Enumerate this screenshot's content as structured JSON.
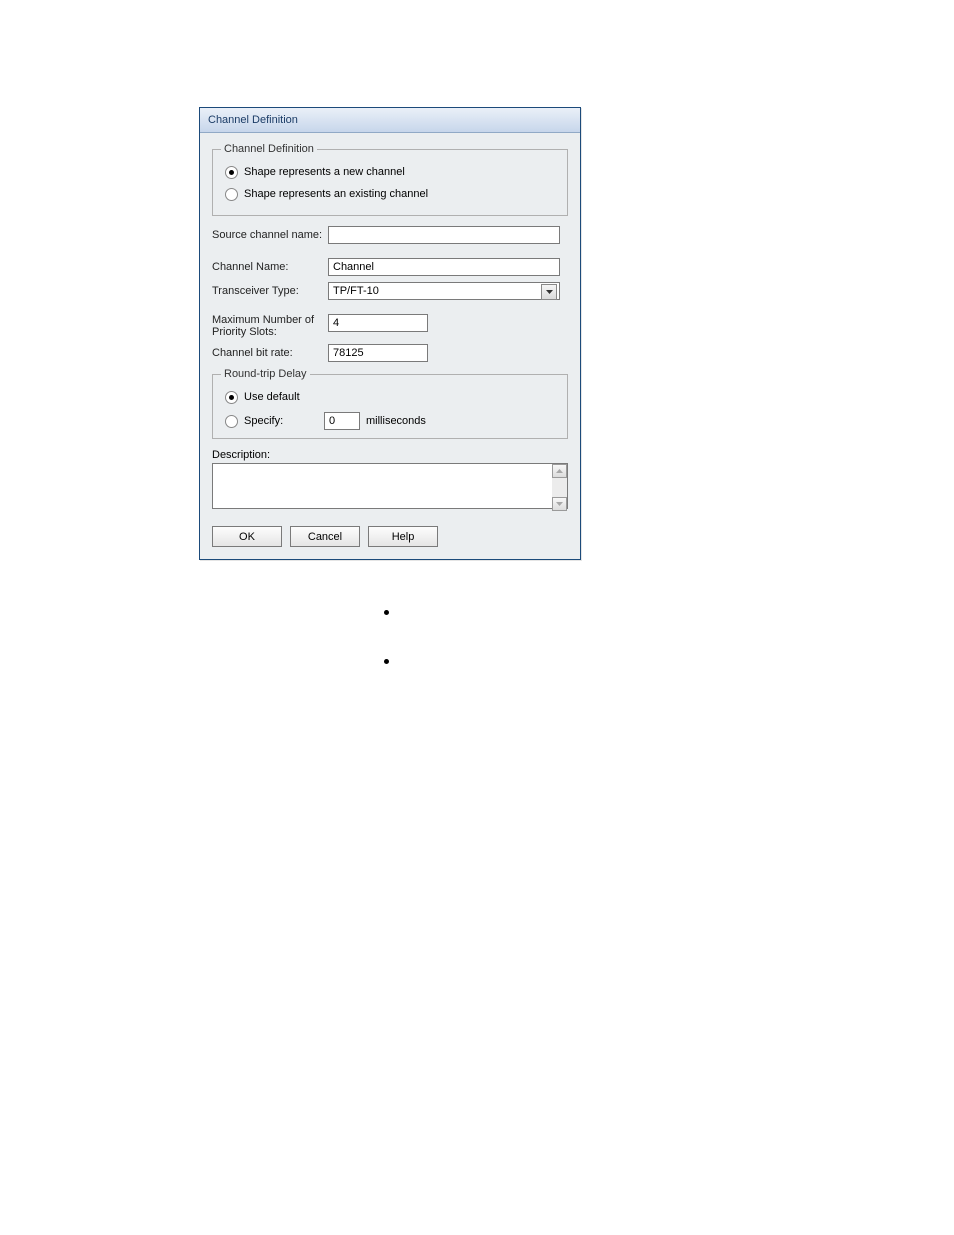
{
  "dialog": {
    "title": "Channel Definition",
    "group_channel_def": {
      "legend": "Channel Definition",
      "radio_new": {
        "label": "Shape represents a new channel",
        "checked": true
      },
      "radio_existing": {
        "label": "Shape represents an existing channel",
        "checked": false
      }
    },
    "source_channel_name": {
      "label": "Source channel name:",
      "value": ""
    },
    "channel_name": {
      "label": "Channel Name:",
      "value": "Channel"
    },
    "transceiver_type": {
      "label": "Transceiver Type:",
      "selected": "TP/FT-10"
    },
    "max_priority_slots": {
      "label_line1": "Maximum  Number of",
      "label_line2": "Priority Slots:",
      "value": "4"
    },
    "channel_bit_rate": {
      "label": "Channel bit rate:",
      "value": "78125"
    },
    "round_trip_delay": {
      "legend": "Round-trip Delay",
      "use_default": {
        "label": "Use default",
        "checked": true
      },
      "specify": {
        "label": "Specify:",
        "checked": false,
        "value": "0",
        "unit": "milliseconds"
      }
    },
    "description": {
      "label": "Description:",
      "value": ""
    },
    "buttons": {
      "ok": "OK",
      "cancel": "Cancel",
      "help": "Help"
    }
  }
}
